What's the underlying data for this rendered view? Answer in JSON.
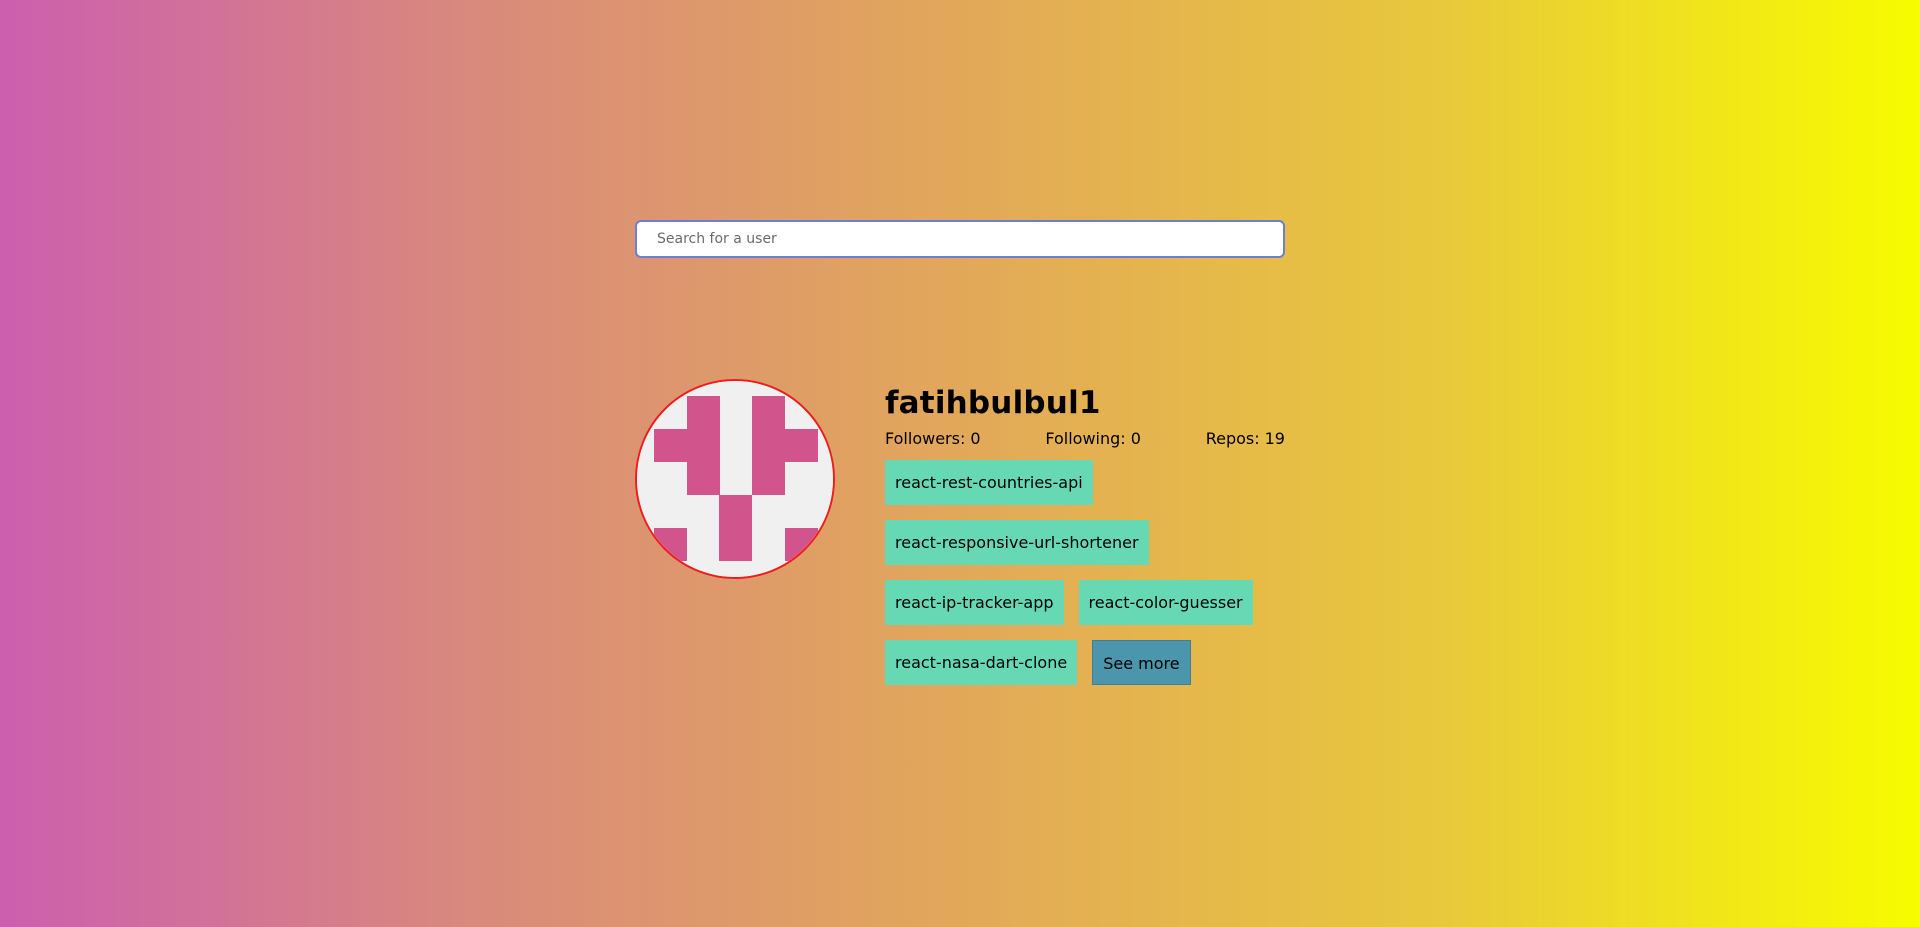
{
  "search": {
    "placeholder": "Search for a user",
    "value": ""
  },
  "profile": {
    "username": "fatihbulbul1",
    "followers_label": "Followers:",
    "followers": "0",
    "following_label": "Following:",
    "following": "0",
    "repos_label": "Repos:",
    "repos": "19",
    "avatar_icon": "identicon-avatar",
    "repo_tags": [
      "react-rest-countries-api",
      "react-responsive-url-shortener",
      "react-ip-tracker-app",
      "react-color-guesser",
      "react-nasa-dart-clone"
    ],
    "see_more_label": "See more"
  },
  "colors": {
    "gradient_start": "#cc5fae",
    "gradient_end": "#f7fc00",
    "repo_tag_bg": "#66d9b4",
    "see_more_bg": "#4b96ac",
    "avatar_border": "#ee1c1c",
    "identicon_fill": "#d1558c",
    "search_border": "#6c7fd8"
  }
}
